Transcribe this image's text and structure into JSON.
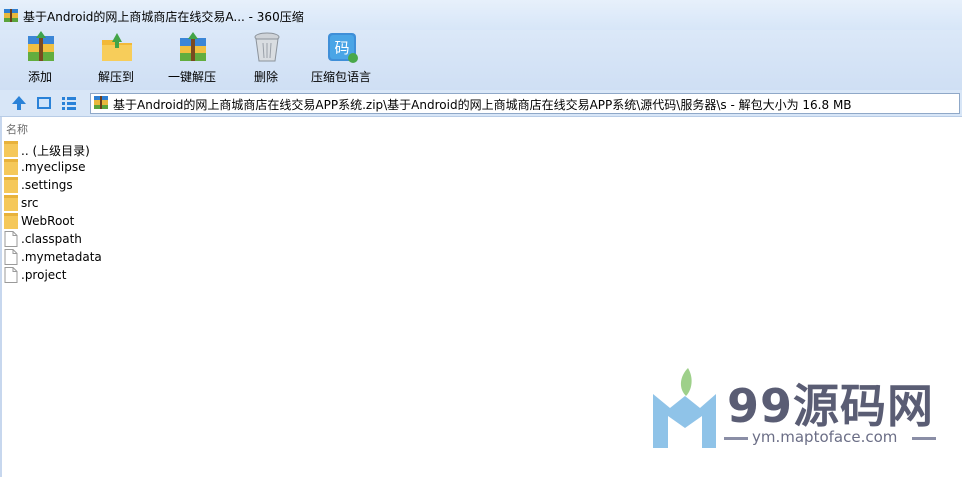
{
  "window": {
    "title": "基于Android的网上商城商店在线交易A... - 360压缩"
  },
  "toolbar": {
    "buttons": [
      {
        "label": "添加",
        "icon": "add-archive-icon"
      },
      {
        "label": "解压到",
        "icon": "extract-to-icon"
      },
      {
        "label": "一键解压",
        "icon": "one-click-extract-icon"
      },
      {
        "label": "删除",
        "icon": "delete-trash-icon"
      },
      {
        "label": "压缩包语言",
        "icon": "archive-language-icon"
      }
    ]
  },
  "addressbar": {
    "path": "基于Android的网上商城商店在线交易APP系统.zip\\基于Android的网上商城商店在线交易APP系统\\源代码\\服务器\\s - 解包大小为 16.8 MB"
  },
  "filelist": {
    "column_name": "名称",
    "items": [
      {
        "name": ".. (上级目录)",
        "type": "folder"
      },
      {
        "name": ".myeclipse",
        "type": "folder"
      },
      {
        "name": ".settings",
        "type": "folder"
      },
      {
        "name": "src",
        "type": "folder"
      },
      {
        "name": "WebRoot",
        "type": "folder"
      },
      {
        "name": ".classpath",
        "type": "file"
      },
      {
        "name": ".mymetadata",
        "type": "file"
      },
      {
        "name": ".project",
        "type": "file"
      }
    ]
  },
  "watermark": {
    "title": "99源码网",
    "url": "ym.maptoface.com"
  },
  "colors": {
    "toolbar_bg": "#d3e3f6",
    "folder": "#f5c85a",
    "watermark_text": "#5a5d74"
  }
}
